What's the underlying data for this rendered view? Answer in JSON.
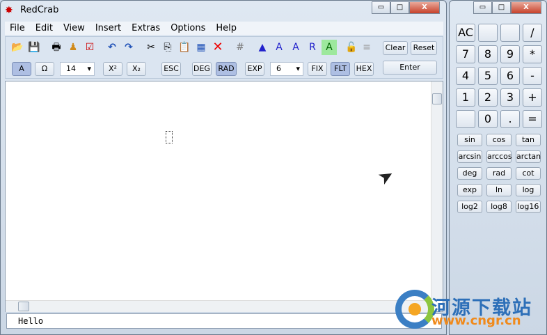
{
  "window": {
    "title": "RedCrab",
    "min": "▭",
    "max": "□",
    "close": "X"
  },
  "menu": [
    "File",
    "Edit",
    "View",
    "Insert",
    "Extras",
    "Options",
    "Help"
  ],
  "toolbar": {
    "clear": "Clear",
    "reset": "Reset",
    "enter": "Enter",
    "font_a": "A",
    "omega": "Ω",
    "font_size": "14",
    "superscript": "X²",
    "subscript": "X₂",
    "esc": "ESC",
    "deg": "DEG",
    "rad": "RAD",
    "exp": "EXP",
    "precision": "6",
    "fix": "FIX",
    "flt": "FLT",
    "hex": "HEX"
  },
  "status": {
    "text": "Hello"
  },
  "calc": {
    "buttons": [
      "AC",
      "",
      "",
      "/",
      "7",
      "8",
      "9",
      "*",
      "4",
      "5",
      "6",
      "-",
      "1",
      "2",
      "3",
      "+",
      "",
      "0",
      ".",
      "="
    ],
    "functions": [
      "sin",
      "cos",
      "tan",
      "arcsin",
      "arccos",
      "arctan",
      "deg",
      "rad",
      "cot",
      "exp",
      "ln",
      "log",
      "log2",
      "log8",
      "log16"
    ]
  },
  "watermark": {
    "name": "河源下载站",
    "url": "www.cngr.cn"
  }
}
